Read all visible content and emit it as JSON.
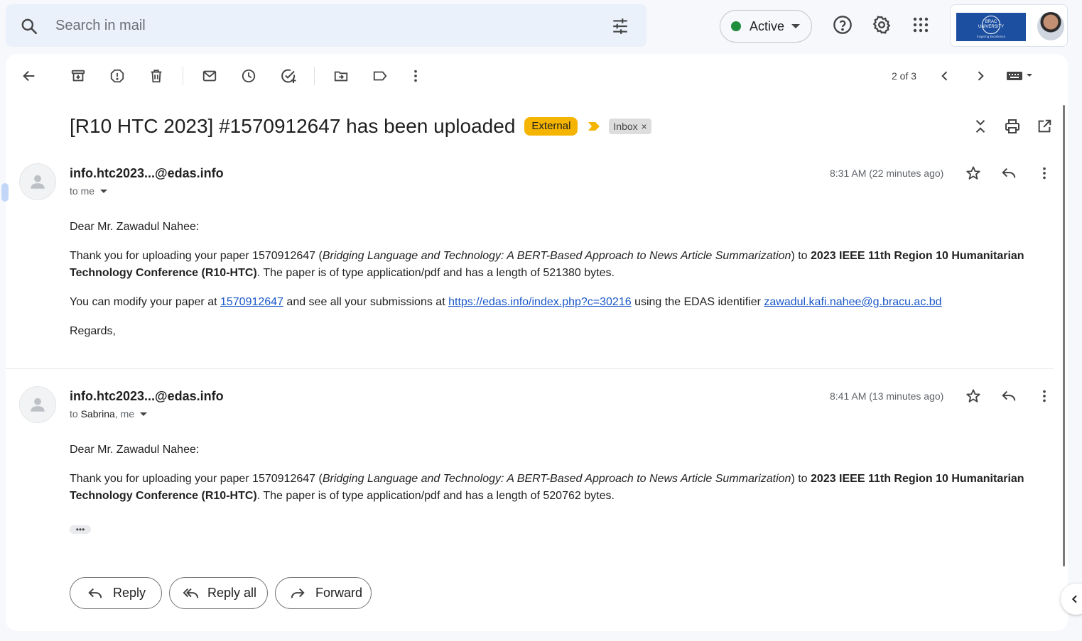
{
  "search": {
    "placeholder": "Search in mail"
  },
  "status": {
    "label": "Active",
    "color": "#1e8e3e"
  },
  "account": {
    "org_logo_text": "BRAC UNIVERSITY",
    "org_tagline": "Inspiring Excellence"
  },
  "toolbar": {
    "pager": "2 of 3"
  },
  "thread": {
    "subject": "[R10 HTC 2023] #1570912647 has been uploaded",
    "labels": {
      "external": "External",
      "inbox": "Inbox",
      "remove": "×"
    }
  },
  "messages": [
    {
      "sender": "info.htc2023...@edas.info",
      "to_prefix": "to me",
      "time": "8:31 AM (22 minutes ago)",
      "greeting": "Dear Mr. Zawadul Nahee:",
      "p1_a": "Thank you for uploading your paper 1570912647 (",
      "p1_title": "Bridging Language and Technology: A BERT-Based Approach to News Article Summarization",
      "p1_b": ") to ",
      "p1_conf": "2023 IEEE 11th Region 10 Humanitarian Technology Conference (R10-HTC)",
      "p1_c": ". The paper is of type application/pdf and has a length of 521380 bytes.",
      "p2_a": "You can modify your paper at ",
      "p2_link1": "1570912647",
      "p2_b": " and see all your submissions at ",
      "p2_link2": "https://edas.info/index.php?c=30216",
      "p2_c": " using the EDAS identifier ",
      "p2_link3": "zawadul.kafi.nahee@g.bracu.ac.bd",
      "closing": "Regards,"
    },
    {
      "sender": "info.htc2023...@edas.info",
      "to_word": "to",
      "to_name": "Sabrina",
      "to_rest": ", me",
      "time": "8:41 AM (13 minutes ago)",
      "greeting": "Dear Mr. Zawadul Nahee:",
      "p1_a": "Thank you for uploading your paper 1570912647 (",
      "p1_title": "Bridging Language and Technology: A BERT-Based Approach to News Article Summarization",
      "p1_b": ") to ",
      "p1_conf": "2023 IEEE 11th Region 10 Humanitarian Technology Conference (R10-HTC)",
      "p1_c": ". The paper is of type application/pdf and has a length of 520762 bytes.",
      "trimmed": "•••"
    }
  ],
  "actions": {
    "reply": "Reply",
    "reply_all": "Reply all",
    "forward": "Forward"
  }
}
